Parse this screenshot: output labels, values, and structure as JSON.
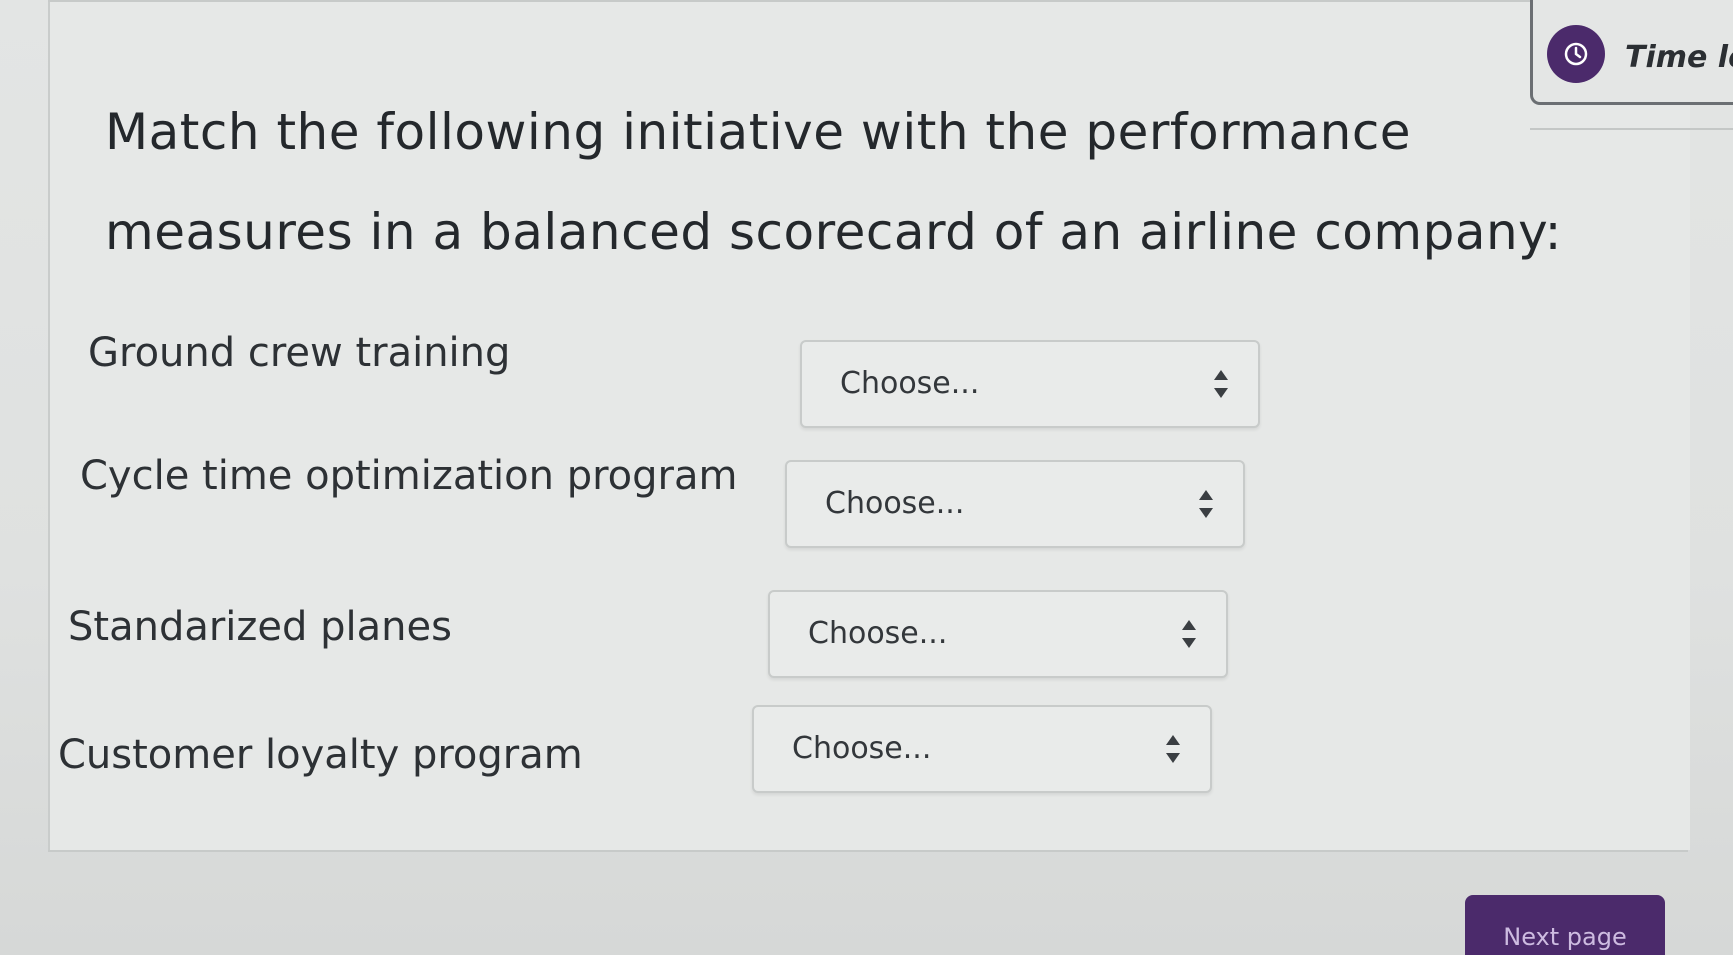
{
  "timer": {
    "label": "Time left"
  },
  "question": {
    "text": "Match the following initiative with the performance measures in a balanced scorecard of an airline company:"
  },
  "rows": [
    {
      "label": "Ground crew training",
      "selected": "Choose..."
    },
    {
      "label": "Cycle time optimization program",
      "selected": "Choose..."
    },
    {
      "label": "Standarized planes",
      "selected": "Choose..."
    },
    {
      "label": "Customer loyalty program",
      "selected": "Choose..."
    }
  ],
  "navigation": {
    "next_label": "Next page"
  },
  "colors": {
    "accent": "#4b2a6b",
    "background": "#e3e5e4"
  },
  "icons": {
    "timer": "timer-icon",
    "select_arrow": "sort-arrows-icon"
  }
}
